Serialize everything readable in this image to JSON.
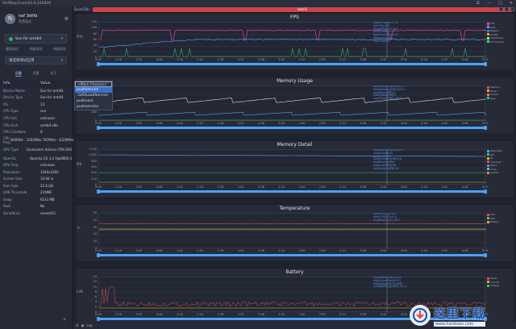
{
  "titlebar": {
    "title": "PerfDog Evolv10.6.240920",
    "controls": [
      "☰",
      "—",
      "□",
      "✕"
    ]
  },
  "user": {
    "name": "naf 3elifa",
    "subtitle": "免费版本",
    "avatar_initial": "N"
  },
  "device": {
    "name": "Sun for arm64",
    "status_color": "#1eb37a"
  },
  "toolbar": {
    "items": [
      "截图测试",
      "性能测试",
      "网络测试"
    ]
  },
  "app_select": {
    "value": "请选择测试应用"
  },
  "panel_tabs": {
    "items": [
      "设备",
      "设置",
      "关于"
    ],
    "active": 0
  },
  "info": {
    "header": {
      "key": "Info",
      "value": "Value"
    },
    "rows": [
      {
        "k": "Device Name",
        "v": "Sun for arm64"
      },
      {
        "k": "Device Type",
        "v": "Sun for arm64"
      },
      {
        "k": "OS",
        "v": "13"
      },
      {
        "k": "CPU Type",
        "v": "sun"
      },
      {
        "k": "CPU Info",
        "v": "unknown"
      },
      {
        "k": "CPU Arch",
        "v": "arm64-v8a"
      },
      {
        "k": "CPU CoreNum",
        "v": "8"
      },
      {
        "k": "CPU Freq",
        "v": "384MHz - 3302MHz\n787MHz - 4320MHz"
      },
      {
        "k": "GPU Type",
        "v": "Qualcomm Adreno (TM) 830"
      },
      {
        "k": "OpenGL",
        "v": "OpenGL ES 3.2 V@0800.4"
      },
      {
        "k": "GPU Freq",
        "v": "unknown"
      },
      {
        "k": "Resolution",
        "v": "1440x3200"
      },
      {
        "k": "Screen Size",
        "v": "10.94 in"
      },
      {
        "k": "Ram Size",
        "v": "22.6 GB"
      },
      {
        "k": "LMK Threshold",
        "v": "216MB"
      },
      {
        "k": "Swap",
        "v": "6143 MB"
      },
      {
        "k": "Root",
        "v": "No"
      },
      {
        "k": "SerialNum",
        "v": "sesee411"
      }
    ]
  },
  "tabs": {
    "scene": "SceneTab",
    "label": "label1"
  },
  "process_menu": {
    "items": [
      "<Main Process>",
      "pushservice",
      ":GAOLoadService",
      "pushcore",
      "pushservice"
    ],
    "selected": 1
  },
  "panels": [
    {
      "title": "FPS",
      "yname": "FPS",
      "yticks": [
        "120",
        "100",
        "80",
        "60",
        "40",
        "20",
        "0"
      ],
      "legend": [
        {
          "c": "#ff40c0",
          "t": "FPS"
        },
        {
          "c": "#5aa0ff",
          "t": "Jank"
        },
        {
          "c": "#1e88e5",
          "t": "BigJank"
        },
        {
          "c": "#e0b020",
          "t": "Stutter"
        },
        {
          "c": "#a0ff60",
          "t": "InterFrame"
        },
        {
          "c": "#40d0c0",
          "t": "FrameTime"
        }
      ],
      "stats": [
        "Avg(FPS)[ms]:57.41",
        "Var(FPS):4.12",
        "Drop(FPS)[/h]:128.5",
        "Jank(/10min):1.4",
        "BigJank(/10min):0.3",
        "Stutter(%):0.14",
        "InterFrame:0"
      ]
    },
    {
      "title": "Memory Usage",
      "yname": "MB",
      "yticks": [
        "800",
        "600",
        "400",
        "200",
        "0"
      ],
      "legend": [
        {
          "c": "#e05050",
          "t": "Memory"
        },
        {
          "c": "#e0b020",
          "t": "Swap"
        },
        {
          "c": "#ff8040",
          "t": "Virtual"
        },
        {
          "c": "#40c070",
          "t": "Java"
        }
      ],
      "stats": [
        "Avg(Memory)[MB]:621.3",
        "Peak(Memory)[MB]:812.0",
        "Avg(Swap)[MB]:0",
        "Peak(Swap)[MB]:0",
        "Avg(Virtual)[MB]:18432"
      ]
    },
    {
      "title": "Memory Detail",
      "yname": "MB",
      "yticks": [
        "1,200",
        "1,000",
        "800",
        "600",
        "400",
        "200",
        "0"
      ],
      "legend": [
        {
          "c": "#5aa0ff",
          "t": "NativePss"
        },
        {
          "c": "#40c070",
          "t": "Gfx"
        },
        {
          "c": "#e0b020",
          "t": "GL"
        },
        {
          "c": "#e05050",
          "t": "Unknown"
        },
        {
          "c": "#b060e0",
          "t": "Stack"
        },
        {
          "c": "#40d0c0",
          "t": "Code"
        },
        {
          "c": "#ff8040",
          "t": "System"
        }
      ],
      "stats": [
        "Avg(NativePss)[MB]:512",
        "Avg(Gfx)[MB]:0",
        "Avg(GL)[MB]:0",
        "Avg(Unknown)[MB]:18",
        "Avg(Stack)[MB]:2",
        "Avg(Code)[MB]:86",
        "Avg(System)[MB]:42"
      ]
    },
    {
      "title": "Temperature",
      "yname": "℃",
      "yticks": [
        "50",
        "40",
        "30",
        "20",
        "10",
        "0"
      ],
      "legend": [
        {
          "c": "#e05050",
          "t": "CPU"
        },
        {
          "c": "#40c070",
          "t": "GPU"
        },
        {
          "c": "#e0b020",
          "t": "Battery"
        }
      ],
      "stats": [
        "Avg(CPU)[℃]:39.2",
        "Max(CPU)[℃]:41.0",
        "Avg(Battery)[℃]:28.0"
      ]
    },
    {
      "title": "Battery",
      "yname": "mW",
      "yticks": [
        "14",
        "12",
        "10",
        "8",
        "6",
        "4",
        "2",
        "0"
      ],
      "legend": [
        {
          "c": "#e05050",
          "t": "Power"
        },
        {
          "c": "#e0b020",
          "t": "Current"
        },
        {
          "c": "#40c070",
          "t": "Voltage"
        }
      ],
      "stats": [
        "Avg(Power)[mW]:1824",
        "Avg(Current)[mA]:412",
        "Avg(Voltage)[mV]:4380",
        "Sum(Battery)[mWh]:152.3"
      ]
    }
  ],
  "xticks": [
    "0:00",
    "0:16",
    "0:32",
    "0:48",
    "1:04",
    "1:20",
    "1:36",
    "1:52",
    "2:08",
    "2:24",
    "2:40",
    "2:56",
    "3:12",
    "3:28",
    "3:44",
    "4:00",
    "4:16",
    "4:32",
    "4:48",
    "5:07"
  ],
  "statusbar": {
    "log_label": "Log"
  },
  "watermark": {
    "title": "这里下载",
    "url": "www.herdown.com"
  }
}
